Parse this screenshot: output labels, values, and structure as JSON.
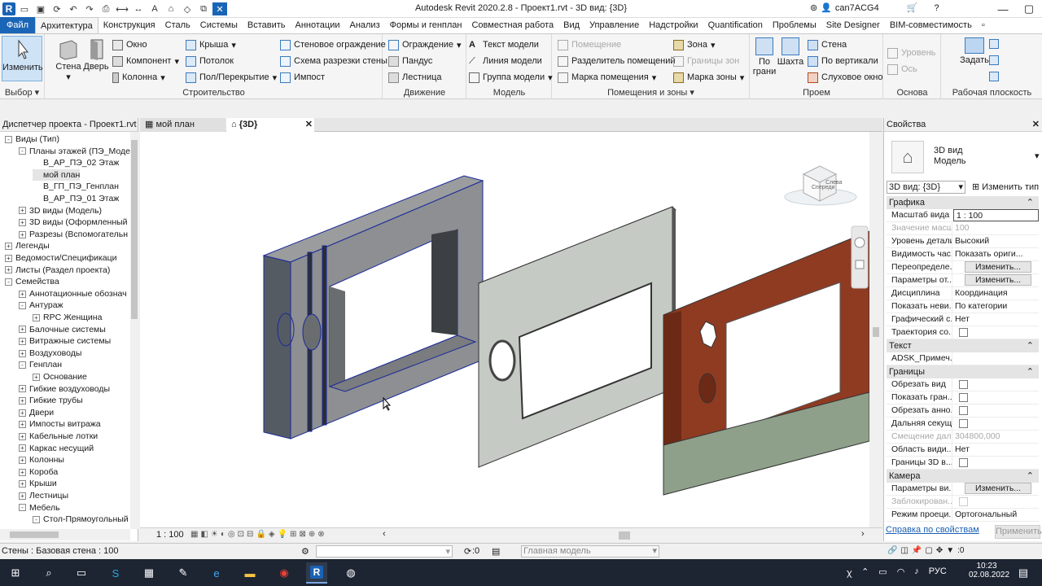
{
  "app": {
    "title": "Autodesk Revit 2020.2.8 - Проект1.rvt - 3D вид: {3D}",
    "user": "can7ACG4"
  },
  "menu": {
    "tabs": [
      "Файл",
      "Архитектура",
      "Конструкция",
      "Сталь",
      "Системы",
      "Вставить",
      "Аннотации",
      "Анализ",
      "Формы и генплан",
      "Совместная работа",
      "Вид",
      "Управление",
      "Надстройки",
      "Quantification",
      "Проблемы",
      "Site Designer",
      "BIM-совместимость"
    ],
    "active": "Архитектура"
  },
  "ribbon": {
    "select": {
      "modify": "Изменить",
      "label": "Выбор"
    },
    "build": {
      "wall": "Стена",
      "door": "Дверь",
      "window": "Окно",
      "component": "Компонент",
      "column": "Колонна",
      "roof": "Крыша",
      "ceiling": "Потолок",
      "floor": "Пол/Перекрытие",
      "curtain_wall": "Стеновое ограждение",
      "curtain_grid": "Схема разрезки стены",
      "mullion": "Импост",
      "label": "Строительство"
    },
    "circulation": {
      "railing": "Ограждение",
      "ramp": "Пандус",
      "stair": "Лестница",
      "label": "Движение"
    },
    "model": {
      "text": "Текст модели",
      "line": "Линия модели",
      "group": "Группа модели",
      "label": "Модель"
    },
    "room": {
      "room": "Помещение",
      "separator": "Разделитель помещений",
      "tag": "Марка помещения",
      "label": "Помещения и зоны"
    },
    "area": {
      "zone": "Зона",
      "zone_boundary": "Границы зон",
      "zone_tag": "Марка зоны"
    },
    "opening": {
      "by_face": "По\nграни",
      "shaft": "Шахта",
      "wall": "Стена",
      "vertical": "По вертикали",
      "dormer": "Слуховое окно",
      "label": "Проем"
    },
    "datum": {
      "level": "Уровень",
      "grid": "Ось",
      "label": "Основа"
    },
    "workplane": {
      "set": "Задать",
      "label": "Рабочая плоскость"
    }
  },
  "browser": {
    "title": "Диспетчер проекта - Проект1.rvt",
    "items": [
      {
        "depth": 0,
        "exp": "-",
        "text": "Виды (Тип)"
      },
      {
        "depth": 1,
        "exp": "-",
        "text": "Планы этажей (ПЭ_Моде"
      },
      {
        "depth": 2,
        "exp": "",
        "text": "В_АР_ПЭ_02 Этаж"
      },
      {
        "depth": 2,
        "exp": "",
        "text": "мой план"
      },
      {
        "depth": 2,
        "exp": "",
        "text": "В_ГП_ПЭ_Генплан"
      },
      {
        "depth": 2,
        "exp": "",
        "text": "В_АР_ПЭ_01 Этаж"
      },
      {
        "depth": 1,
        "exp": "+",
        "text": "3D виды (Модель)"
      },
      {
        "depth": 1,
        "exp": "+",
        "text": "3D виды (Оформленный"
      },
      {
        "depth": 1,
        "exp": "+",
        "text": "Разрезы (Вспомогательн"
      },
      {
        "depth": 0,
        "exp": "+",
        "text": "Легенды"
      },
      {
        "depth": 0,
        "exp": "+",
        "text": "Ведомости/Спецификаци"
      },
      {
        "depth": 0,
        "exp": "+",
        "text": "Листы (Раздел проекта)"
      },
      {
        "depth": 0,
        "exp": "-",
        "text": "Семейства"
      },
      {
        "depth": 1,
        "exp": "+",
        "text": "Аннотационные обознач"
      },
      {
        "depth": 1,
        "exp": "-",
        "text": "Антураж"
      },
      {
        "depth": 2,
        "exp": "+",
        "text": "RPC Женщина"
      },
      {
        "depth": 1,
        "exp": "+",
        "text": "Балочные системы"
      },
      {
        "depth": 1,
        "exp": "+",
        "text": "Витражные системы"
      },
      {
        "depth": 1,
        "exp": "+",
        "text": "Воздуховоды"
      },
      {
        "depth": 1,
        "exp": "-",
        "text": "Генплан"
      },
      {
        "depth": 2,
        "exp": "+",
        "text": "Основание"
      },
      {
        "depth": 1,
        "exp": "+",
        "text": "Гибкие воздуховоды"
      },
      {
        "depth": 1,
        "exp": "+",
        "text": "Гибкие трубы"
      },
      {
        "depth": 1,
        "exp": "+",
        "text": "Двери"
      },
      {
        "depth": 1,
        "exp": "+",
        "text": "Импосты витража"
      },
      {
        "depth": 1,
        "exp": "+",
        "text": "Кабельные лотки"
      },
      {
        "depth": 1,
        "exp": "+",
        "text": "Каркас несущий"
      },
      {
        "depth": 1,
        "exp": "+",
        "text": "Колонны"
      },
      {
        "depth": 1,
        "exp": "+",
        "text": "Короба"
      },
      {
        "depth": 1,
        "exp": "+",
        "text": "Крыши"
      },
      {
        "depth": 1,
        "exp": "+",
        "text": "Лестницы"
      },
      {
        "depth": 1,
        "exp": "-",
        "text": "Мебель"
      },
      {
        "depth": 2,
        "exp": "-",
        "text": "Стол-Прямоугольный"
      }
    ]
  },
  "views": {
    "tab1": "мой план",
    "tab2": "{3D}",
    "scale": "1 : 100"
  },
  "viewcube": {
    "face1": "Спереди",
    "face2": "Слева"
  },
  "props": {
    "title": "Свойства",
    "family": "3D вид",
    "subtype": "Модель",
    "type_select": "3D вид: {3D}",
    "edit_type": "Изменить тип",
    "sec_graphics": "Графика",
    "sec_text": "Текст",
    "sec_bounds": "Границы",
    "sec_camera": "Камера",
    "rows": {
      "r1k": "Масштаб вида",
      "r1v": "1 : 100",
      "r2k": "Значение масш...",
      "r2v": "100",
      "r3k": "Уровень детали...",
      "r3v": "Высокий",
      "r4k": "Видимость час...",
      "r4v": "Показать ориги...",
      "r5k": "Переопределе...",
      "r5v": "Изменить...",
      "r6k": "Параметры от...",
      "r6v": "Изменить...",
      "r7k": "Дисциплина",
      "r7v": "Координация",
      "r8k": "Показать неви...",
      "r8v": "По категории",
      "r9k": "Графический с...",
      "r9v": "Нет",
      "r10k": "Траектория со...",
      "r11k": "ADSK_Примеч...",
      "r12k": "Обрезать вид",
      "r13k": "Показать гран...",
      "r14k": "Обрезать анно...",
      "r15k": "Дальняя секущ...",
      "r16k": "Смещение дал...",
      "r16v": "304800,000",
      "r17k": "Область види...",
      "r17v": "Нет",
      "r18k": "Границы 3D в...",
      "r19k": "Параметры ви...",
      "r19v": "Изменить...",
      "r20k": "Заблокирован...",
      "r21k": "Режим проеци...",
      "r21v": "Ортогональный"
    },
    "help": "Справка по свойствам",
    "apply": "Применить"
  },
  "status": {
    "text": "Стены : Базовая стена : 100",
    "counter": ":0",
    "model": "Главная модель",
    "filter": ":0"
  },
  "taskbar": {
    "lang": "РУС",
    "time": "10:23",
    "date": "02.08.2022"
  }
}
